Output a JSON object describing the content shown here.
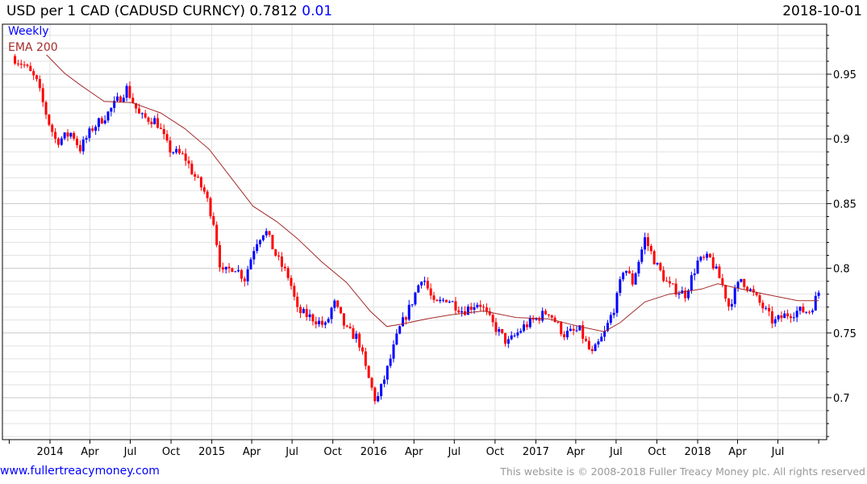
{
  "header": {
    "title": "USD per 1 CAD (CADUSD CURNCY) 0.7812",
    "change": "0.01",
    "date": "2018-10-01"
  },
  "legend": {
    "frequency": "Weekly",
    "ema": "EMA 200"
  },
  "footer": {
    "link": "www.fullertreacymoney.com",
    "copyright": "This website is © 2008-2018 Fuller Treacy Money plc. All rights reserved"
  },
  "colors": {
    "up": "#0000ff",
    "down": "#ff0000",
    "ema": "#a52a2a",
    "grid": "#e2e2e2",
    "major_grid": "#c8c8c8"
  },
  "chart_data": {
    "type": "candlestick",
    "frequency": "weekly",
    "ylim": [
      0.6676,
      0.9887
    ],
    "y_ticks": [
      "0.7",
      "0.75",
      "0.8",
      "0.85",
      "0.9",
      "0.95"
    ],
    "y_tick_values": [
      0.7,
      0.75,
      0.8,
      0.85,
      0.9,
      0.95
    ],
    "x_ticks": [
      {
        "label": "2014",
        "date": "2014-01-01"
      },
      {
        "label": "Apr",
        "date": "2014-04-01"
      },
      {
        "label": "Jul",
        "date": "2014-07-01"
      },
      {
        "label": "Oct",
        "date": "2014-10-01"
      },
      {
        "label": "2015",
        "date": "2015-01-01"
      },
      {
        "label": "Apr",
        "date": "2015-04-01"
      },
      {
        "label": "Jul",
        "date": "2015-07-01"
      },
      {
        "label": "Oct",
        "date": "2015-10-01"
      },
      {
        "label": "2016",
        "date": "2016-01-01"
      },
      {
        "label": "Apr",
        "date": "2016-04-01"
      },
      {
        "label": "Jul",
        "date": "2016-07-01"
      },
      {
        "label": "Oct",
        "date": "2016-10-01"
      },
      {
        "label": "2017",
        "date": "2017-01-01"
      },
      {
        "label": "Apr",
        "date": "2017-04-01"
      },
      {
        "label": "Jul",
        "date": "2017-07-01"
      },
      {
        "label": "Oct",
        "date": "2017-10-01"
      },
      {
        "label": "2018",
        "date": "2018-01-01"
      },
      {
        "label": "Apr",
        "date": "2018-04-01"
      },
      {
        "label": "Jul",
        "date": "2018-07-01"
      }
    ],
    "price_close": [
      [
        "2013-10-07",
        0.964
      ],
      [
        "2013-11-04",
        0.957
      ],
      [
        "2013-12-01",
        0.945
      ],
      [
        "2013-12-28",
        0.914
      ],
      [
        "2014-01-15",
        0.898
      ],
      [
        "2014-02-20",
        0.905
      ],
      [
        "2014-03-09",
        0.892
      ],
      [
        "2014-04-06",
        0.908
      ],
      [
        "2014-05-12",
        0.92
      ],
      [
        "2014-06-23",
        0.939
      ],
      [
        "2014-07-23",
        0.917
      ],
      [
        "2014-08-29",
        0.914
      ],
      [
        "2014-09-26",
        0.892
      ],
      [
        "2014-11-01",
        0.886
      ],
      [
        "2014-11-20",
        0.873
      ],
      [
        "2014-12-17",
        0.858
      ],
      [
        "2015-01-05",
        0.836
      ],
      [
        "2015-01-23",
        0.795
      ],
      [
        "2015-02-20",
        0.802
      ],
      [
        "2015-03-16",
        0.792
      ],
      [
        "2015-04-10",
        0.82
      ],
      [
        "2015-05-01",
        0.83
      ],
      [
        "2015-05-28",
        0.808
      ],
      [
        "2015-06-25",
        0.792
      ],
      [
        "2015-07-13",
        0.767
      ],
      [
        "2015-08-19",
        0.761
      ],
      [
        "2015-09-15",
        0.755
      ],
      [
        "2015-10-03",
        0.774
      ],
      [
        "2015-11-01",
        0.752
      ],
      [
        "2015-11-27",
        0.746
      ],
      [
        "2015-12-15",
        0.721
      ],
      [
        "2016-01-07",
        0.696
      ],
      [
        "2016-01-31",
        0.721
      ],
      [
        "2016-02-27",
        0.752
      ],
      [
        "2016-03-24",
        0.771
      ],
      [
        "2016-04-20",
        0.795
      ],
      [
        "2016-05-17",
        0.771
      ],
      [
        "2016-06-14",
        0.777
      ],
      [
        "2016-07-20",
        0.767
      ],
      [
        "2016-08-26",
        0.774
      ],
      [
        "2016-09-23",
        0.758
      ],
      [
        "2016-10-29",
        0.742
      ],
      [
        "2016-12-05",
        0.755
      ],
      [
        "2017-01-02",
        0.761
      ],
      [
        "2017-01-29",
        0.767
      ],
      [
        "2017-03-05",
        0.749
      ],
      [
        "2017-04-10",
        0.752
      ],
      [
        "2017-05-07",
        0.733
      ],
      [
        "2017-06-04",
        0.749
      ],
      [
        "2017-07-01",
        0.774
      ],
      [
        "2017-07-19",
        0.802
      ],
      [
        "2017-08-07",
        0.789
      ],
      [
        "2017-09-04",
        0.823
      ],
      [
        "2017-10-01",
        0.802
      ],
      [
        "2017-10-28",
        0.786
      ],
      [
        "2017-12-04",
        0.78
      ],
      [
        "2018-01-01",
        0.805
      ],
      [
        "2018-01-28",
        0.808
      ],
      [
        "2018-02-24",
        0.789
      ],
      [
        "2018-03-12",
        0.771
      ],
      [
        "2018-04-09",
        0.792
      ],
      [
        "2018-05-06",
        0.78
      ],
      [
        "2018-06-03",
        0.767
      ],
      [
        "2018-06-21",
        0.758
      ],
      [
        "2018-07-18",
        0.764
      ],
      [
        "2018-08-15",
        0.767
      ],
      [
        "2018-09-11",
        0.767
      ],
      [
        "2018-10-01",
        0.7812
      ]
    ],
    "ema_200": [
      [
        "2013-12-24",
        0.965
      ],
      [
        "2014-02-02",
        0.951
      ],
      [
        "2014-03-09",
        0.942
      ],
      [
        "2014-05-03",
        0.929
      ],
      [
        "2014-07-05",
        0.928
      ],
      [
        "2014-09-08",
        0.92
      ],
      [
        "2014-11-01",
        0.908
      ],
      [
        "2014-12-26",
        0.892
      ],
      [
        "2015-02-20",
        0.867
      ],
      [
        "2015-04-04",
        0.848
      ],
      [
        "2015-05-28",
        0.836
      ],
      [
        "2015-07-13",
        0.823
      ],
      [
        "2015-09-06",
        0.805
      ],
      [
        "2015-11-01",
        0.789
      ],
      [
        "2015-12-24",
        0.767
      ],
      [
        "2016-01-31",
        0.755
      ],
      [
        "2016-03-06",
        0.757
      ],
      [
        "2016-04-30",
        0.761
      ],
      [
        "2016-06-23",
        0.764
      ],
      [
        "2016-09-05",
        0.767
      ],
      [
        "2016-11-17",
        0.762
      ],
      [
        "2017-01-29",
        0.761
      ],
      [
        "2017-04-10",
        0.755
      ],
      [
        "2017-06-04",
        0.751
      ],
      [
        "2017-07-10",
        0.758
      ],
      [
        "2017-09-04",
        0.774
      ],
      [
        "2017-10-28",
        0.78
      ],
      [
        "2018-01-10",
        0.784
      ],
      [
        "2018-02-15",
        0.788
      ],
      [
        "2018-04-09",
        0.784
      ],
      [
        "2018-06-03",
        0.78
      ],
      [
        "2018-08-15",
        0.775
      ],
      [
        "2018-10-01",
        0.775
      ]
    ]
  }
}
